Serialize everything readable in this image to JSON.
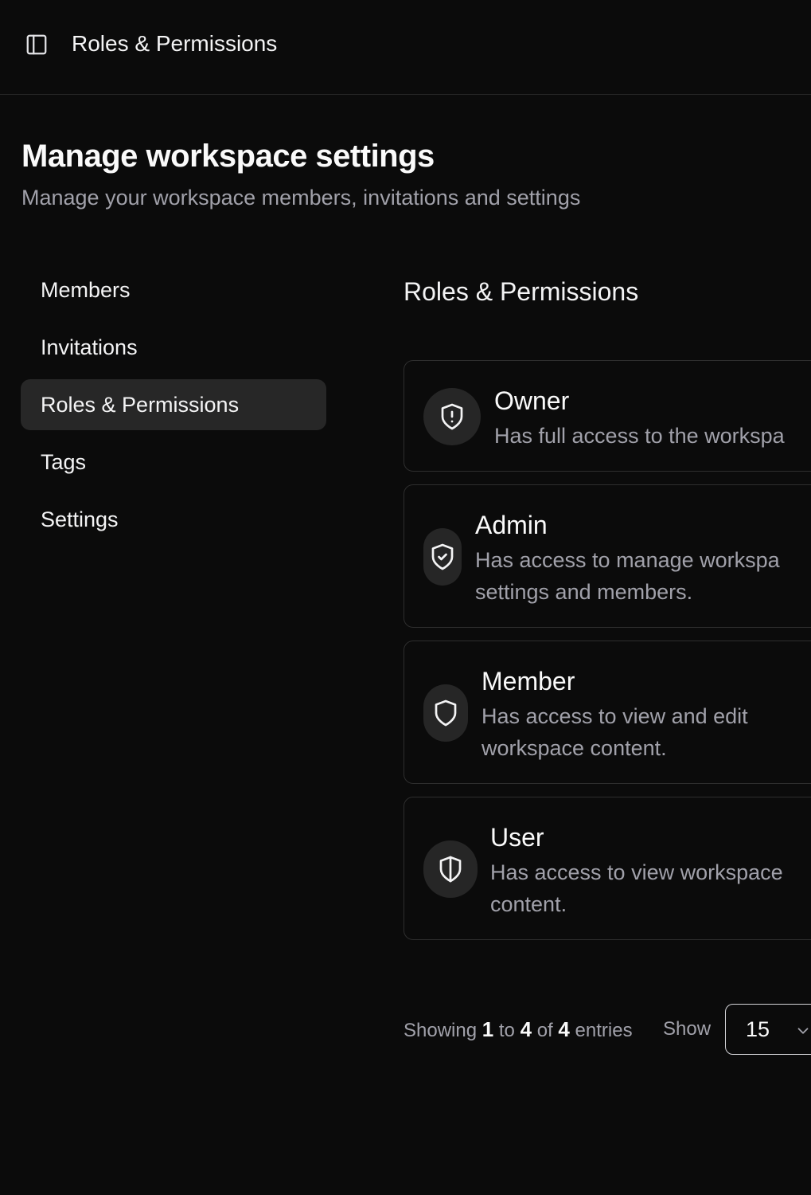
{
  "header": {
    "title": "Roles & Permissions",
    "toggle_icon": "sidebar-panel-icon"
  },
  "page": {
    "title": "Manage workspace settings",
    "subtitle": "Manage your workspace members, invitations and settings"
  },
  "nav": {
    "items": [
      {
        "label": "Members"
      },
      {
        "label": "Invitations"
      },
      {
        "label": "Roles & Permissions",
        "active": true
      },
      {
        "label": "Tags"
      },
      {
        "label": "Settings"
      }
    ]
  },
  "section": {
    "title": "Roles & Permissions"
  },
  "roles": [
    {
      "name": "Owner",
      "desc_lines": [
        "Has full access to the workspa"
      ],
      "icon": "shield-alert-icon"
    },
    {
      "name": "Admin",
      "desc_lines": [
        "Has access to manage workspa",
        "settings and members."
      ],
      "icon": "shield-check-icon"
    },
    {
      "name": "Member",
      "desc_lines": [
        "Has access to view and edit",
        "workspace content."
      ],
      "icon": "shield-icon"
    },
    {
      "name": "User",
      "desc_lines": [
        "Has access to view workspace",
        "content."
      ],
      "icon": "shield-half-icon"
    }
  ],
  "pagination": {
    "showing": "Showing",
    "from": "1",
    "to_word": "to",
    "to": "4",
    "of_word": "of",
    "total": "4",
    "entries_word": "entries",
    "show_label": "Show",
    "page_size": "15"
  },
  "colors": {
    "background": "#0b0b0b",
    "active_nav": "#272727",
    "muted_text": "#a1a1aa",
    "card_border": "#2e2e2e"
  }
}
